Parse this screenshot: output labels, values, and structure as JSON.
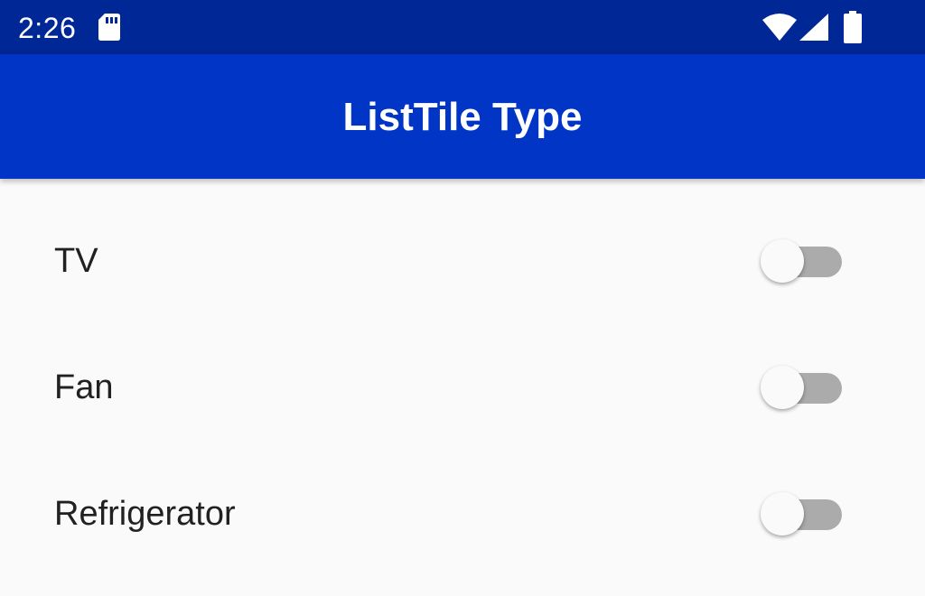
{
  "status_bar": {
    "time": "2:26",
    "icons": [
      "sd-card-icon",
      "wifi-icon",
      "cell-signal-icon",
      "battery-icon"
    ]
  },
  "app_bar": {
    "title": "ListTile Type"
  },
  "list": {
    "items": [
      {
        "label": "TV",
        "switch_on": false
      },
      {
        "label": "Fan",
        "switch_on": false
      },
      {
        "label": "Refrigerator",
        "switch_on": false
      }
    ]
  },
  "colors": {
    "status_bar": "#002796",
    "app_bar": "#0035c6",
    "background": "#fafafa",
    "switch_track_off": "#ababab",
    "switch_thumb_off": "#fafafa",
    "label_text": "#212121"
  }
}
